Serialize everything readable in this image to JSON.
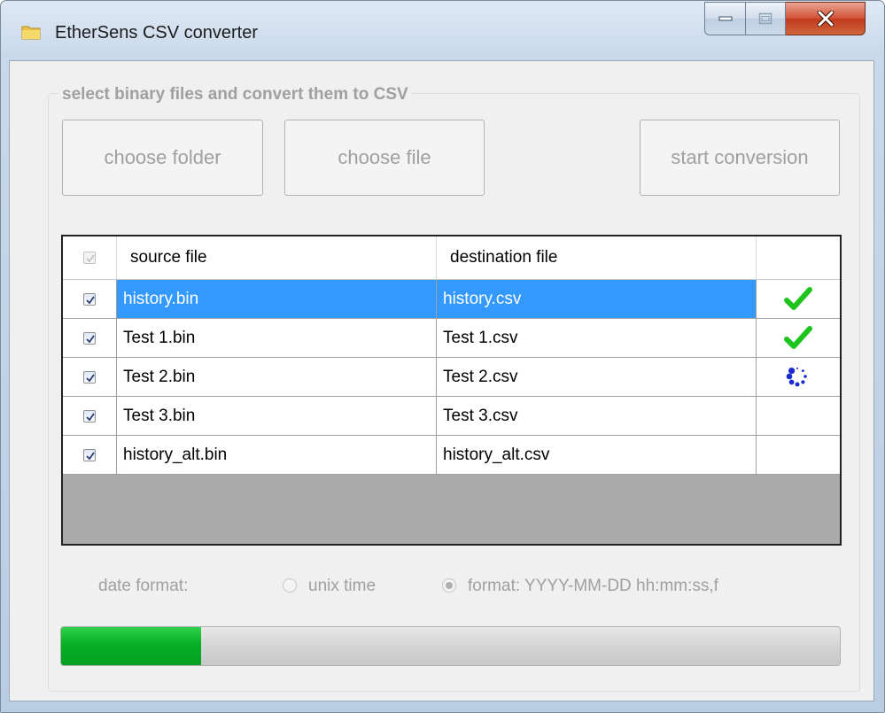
{
  "window": {
    "title": "EtherSens CSV converter"
  },
  "group": {
    "legend": "select binary files and convert them to CSV"
  },
  "buttons": {
    "choose_folder": "choose folder",
    "choose_file": "choose file",
    "start_conversion": "start conversion"
  },
  "grid": {
    "header": {
      "select_all_checked": true,
      "source": "source file",
      "destination": "destination file",
      "status": ""
    },
    "rows": [
      {
        "checked": true,
        "source": "history.bin",
        "destination": "history.csv",
        "status": "done",
        "selected": true
      },
      {
        "checked": true,
        "source": "Test 1.bin",
        "destination": "Test 1.csv",
        "status": "done",
        "selected": false
      },
      {
        "checked": true,
        "source": "Test 2.bin",
        "destination": "Test 2.csv",
        "status": "in-progress",
        "selected": false
      },
      {
        "checked": true,
        "source": "Test 3.bin",
        "destination": "Test 3.csv",
        "status": "pending",
        "selected": false
      },
      {
        "checked": true,
        "source": "history_alt.bin",
        "destination": "history_alt.csv",
        "status": "pending",
        "selected": false
      }
    ]
  },
  "date_format": {
    "label": "date format:",
    "options": [
      {
        "label": "unix time",
        "checked": false
      },
      {
        "label": "format: YYYY-MM-DD hh:mm:ss,f",
        "checked": true
      }
    ]
  },
  "progress": {
    "value": 0.18
  },
  "colors": {
    "selection": "#3399ff",
    "check_done": "#1ec41e",
    "spinner": "#1a2bd1",
    "progress_fill": "#06b025"
  },
  "icons": {
    "done": "checkmark-icon",
    "in_progress": "spinner-icon"
  }
}
